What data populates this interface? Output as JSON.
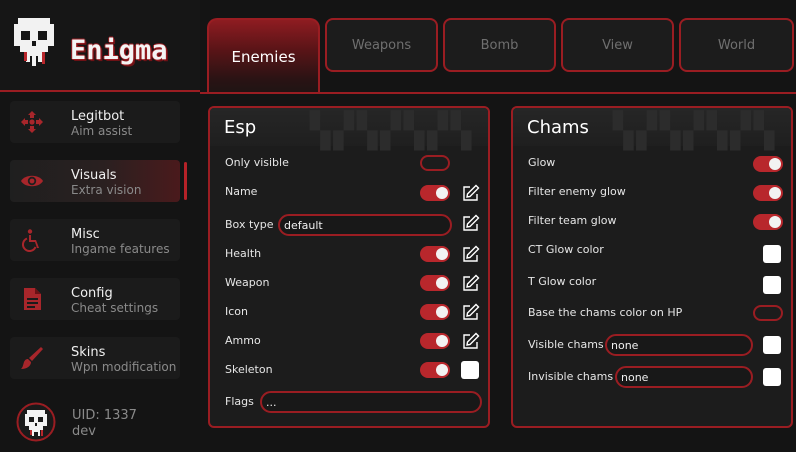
{
  "app": {
    "title": "Enigma"
  },
  "tabs": [
    {
      "label": "Enemies",
      "active": true
    },
    {
      "label": "Weapons",
      "active": false
    },
    {
      "label": "Bomb",
      "active": false
    },
    {
      "label": "View",
      "active": false
    },
    {
      "label": "World",
      "active": false
    }
  ],
  "sidebar": {
    "items": [
      {
        "title": "Legitbot",
        "subtitle": "Aim assist",
        "icon": "crosshair-icon",
        "active": false
      },
      {
        "title": "Visuals",
        "subtitle": "Extra vision",
        "icon": "eye-icon",
        "active": true
      },
      {
        "title": "Misc",
        "subtitle": "Ingame features",
        "icon": "wheelchair-icon",
        "active": false
      },
      {
        "title": "Config",
        "subtitle": "Cheat settings",
        "icon": "document-icon",
        "active": false
      },
      {
        "title": "Skins",
        "subtitle": "Wpn modification",
        "icon": "paintbrush-icon",
        "active": false
      }
    ]
  },
  "user": {
    "uid": "UID: 1337",
    "name": "dev"
  },
  "esp": {
    "title": "Esp",
    "only_visible": {
      "label": "Only visible",
      "enabled": false
    },
    "name": {
      "label": "Name",
      "enabled": true
    },
    "box_type": {
      "label": "Box type",
      "value": "default"
    },
    "health": {
      "label": "Health",
      "enabled": true
    },
    "weapon": {
      "label": "Weapon",
      "enabled": true
    },
    "icon": {
      "label": "Icon",
      "enabled": true
    },
    "ammo": {
      "label": "Ammo",
      "enabled": true
    },
    "skeleton": {
      "label": "Skeleton",
      "enabled": true
    },
    "flags": {
      "label": "Flags",
      "value": "..."
    }
  },
  "chams": {
    "title": "Chams",
    "glow": {
      "label": "Glow",
      "enabled": true
    },
    "filter_enemy_glow": {
      "label": "Filter enemy glow",
      "enabled": true
    },
    "filter_team_glow": {
      "label": "Filter team glow",
      "enabled": true
    },
    "ct_glow_color": {
      "label": "CT Glow color",
      "color": "#ffffff"
    },
    "t_glow_color": {
      "label": "T Glow color",
      "color": "#ffffff"
    },
    "base_on_hp": {
      "label": "Base the chams color on HP",
      "enabled": false
    },
    "visible_chams": {
      "label": "Visible chams",
      "value": "none"
    },
    "invisible_chams": {
      "label": "Invisible chams",
      "value": "none"
    }
  },
  "colors": {
    "accent": "#b8272c",
    "accent_dark": "#9a1d22",
    "background": "#141414",
    "panel": "#1c1c1c"
  }
}
